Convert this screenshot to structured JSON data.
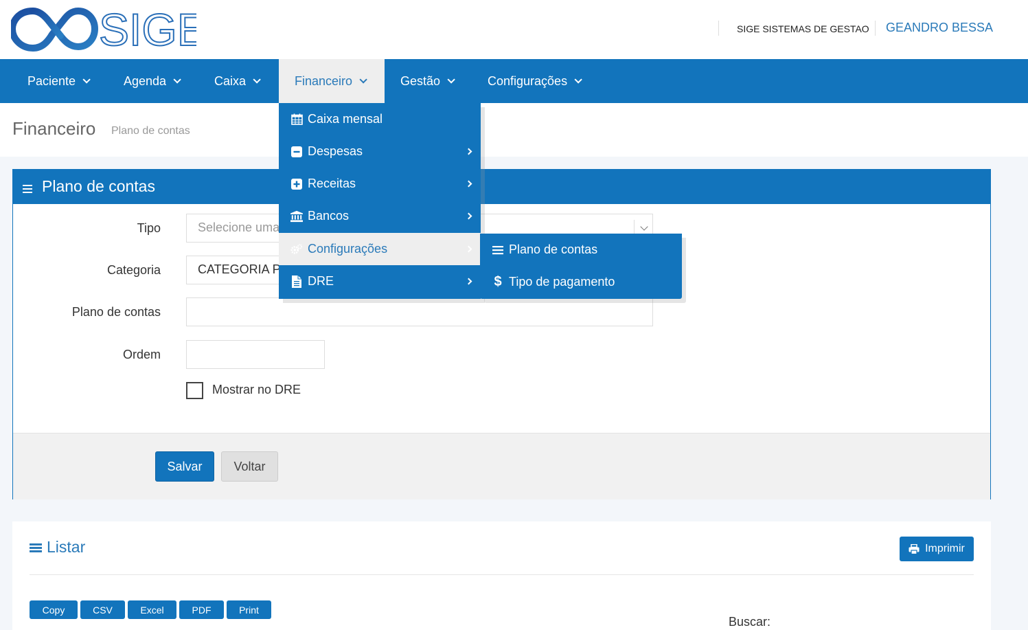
{
  "header": {
    "logo_text": "SIGE",
    "company": "SIGE SISTEMAS DE GESTAO",
    "user": "GEANDRO BESSA"
  },
  "nav": {
    "items": [
      {
        "label": "Paciente"
      },
      {
        "label": "Agenda"
      },
      {
        "label": "Caixa"
      },
      {
        "label": "Financeiro"
      },
      {
        "label": "Gestão"
      },
      {
        "label": "Configurações"
      }
    ],
    "active": "Financeiro"
  },
  "page": {
    "title": "Financeiro",
    "subtitle": "Plano de contas"
  },
  "form": {
    "panel_title": "Plano de contas",
    "tipo_label": "Tipo",
    "tipo_placeholder": "Selecione uma",
    "categoria_label": "Categoria",
    "categoria_value": "CATEGORIA P",
    "plano_label": "Plano de contas",
    "plano_value": "",
    "ordem_label": "Ordem",
    "ordem_value": "",
    "dre_label": "Mostrar no DRE",
    "dre_checked": false,
    "save_label": "Salvar",
    "back_label": "Voltar"
  },
  "list": {
    "title": "Listar",
    "print_label": "Imprimir",
    "export_buttons": [
      "Copy",
      "CSV",
      "Excel",
      "PDF",
      "Print"
    ],
    "search_label": "Buscar:"
  },
  "dropdown": {
    "items": [
      {
        "label": "Caixa mensal",
        "icon": "calendar-icon",
        "has_sub": false
      },
      {
        "label": "Despesas",
        "icon": "minus-square-icon",
        "has_sub": true
      },
      {
        "label": "Receitas",
        "icon": "plus-square-icon",
        "has_sub": true
      },
      {
        "label": "Bancos",
        "icon": "bank-icon",
        "has_sub": true
      },
      {
        "label": "Configurações",
        "icon": "cogs-icon",
        "has_sub": true
      },
      {
        "label": "DRE",
        "icon": "file-icon",
        "has_sub": true
      }
    ],
    "hovered": "Configurações",
    "submenu": [
      {
        "label": "Plano de contas",
        "icon": "bars-icon"
      },
      {
        "label": "Tipo de pagamento",
        "icon": "dollar-icon"
      }
    ]
  },
  "colors": {
    "primary": "#1274bc",
    "link": "#2a7ab9",
    "hover_bg": "#eeeeee"
  }
}
